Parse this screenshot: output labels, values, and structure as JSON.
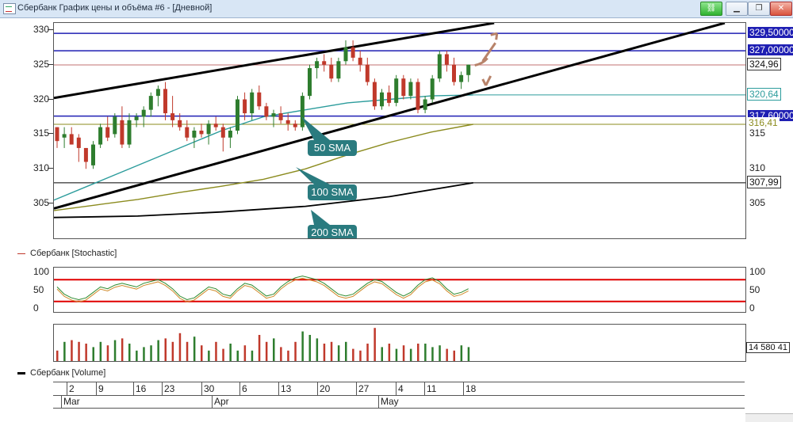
{
  "window": {
    "title": "Сбербанк График цены и объёма #6 - [Дневной]",
    "buttons": [
      "link",
      "minimize",
      "restore",
      "close"
    ]
  },
  "price_panel": {
    "y_ticks_left": [
      "330",
      "325",
      "320",
      "315",
      "310",
      "305"
    ],
    "y_ticks_right": [
      "315",
      "310",
      "305"
    ],
    "price_tags": [
      {
        "label": "329,50000",
        "style": "blue"
      },
      {
        "label": "327,00000",
        "style": "blue"
      },
      {
        "label": "324,96",
        "style": "plain"
      },
      {
        "label": "320,64",
        "style": "teal"
      },
      {
        "label": "317,60000",
        "style": "blue"
      },
      {
        "label": "316,41",
        "style": "olive"
      },
      {
        "label": "307,99",
        "style": "plain"
      }
    ],
    "callouts": [
      "50 SMA",
      "100 SMA",
      "200 SMA"
    ]
  },
  "stochastic_panel": {
    "legend": "Сбербанк [Stochastic]",
    "y_ticks": [
      "100",
      "50",
      "0"
    ]
  },
  "volume_panel": {
    "legend": "Сбербанк [Volume]",
    "last_volume": "14 580 41"
  },
  "x_axis": {
    "day_labels": [
      "2",
      "9",
      "16",
      "23",
      "30",
      "6",
      "13",
      "20",
      "27",
      "4",
      "11",
      "18"
    ],
    "month_labels": [
      "Mar",
      "Apr",
      "May"
    ]
  },
  "colors": {
    "up": "#2e7d2e",
    "down": "#c0392b",
    "sma50": "#2c9c9c",
    "sma100": "#8b8b1e",
    "sma200": "#000000",
    "level_blue": "#1f1fb3",
    "callout": "#2a7b7f",
    "arrow": "#b8836a",
    "stoch_band": "#e00000"
  },
  "chart_data": {
    "type": "candlestick",
    "price_range": [
      300,
      331
    ],
    "candles": [
      [
        316,
        316,
        313,
        314
      ],
      [
        314.5,
        316,
        313,
        315
      ],
      [
        315,
        316,
        313.5,
        313.5
      ],
      [
        314.5,
        315,
        311,
        313
      ],
      [
        313,
        313,
        310,
        311
      ],
      [
        310.5,
        314,
        310,
        313.5
      ],
      [
        313.5,
        316.5,
        313,
        316
      ],
      [
        316,
        317.5,
        314,
        314.5
      ],
      [
        315,
        318,
        314.5,
        317.5
      ],
      [
        317,
        319,
        313,
        313.5
      ],
      [
        313.5,
        318,
        313,
        317
      ],
      [
        317,
        318,
        316,
        317.5
      ],
      [
        317.5,
        319,
        316,
        318.5
      ],
      [
        318.5,
        321,
        317.5,
        320.5
      ],
      [
        320.5,
        322,
        319,
        321.5
      ],
      [
        321.5,
        322.5,
        317,
        318
      ],
      [
        318,
        320.5,
        316,
        317
      ],
      [
        317,
        318,
        315.5,
        316
      ],
      [
        316,
        317,
        314,
        314.5
      ],
      [
        314.5,
        316,
        313,
        315.5
      ],
      [
        315.5,
        316.5,
        314.5,
        315
      ],
      [
        315,
        317,
        313.5,
        316.5
      ],
      [
        316.5,
        317.5,
        315.5,
        316
      ],
      [
        316,
        316.5,
        312.5,
        314.5
      ],
      [
        314.5,
        316,
        313,
        315.5
      ],
      [
        315.5,
        320.5,
        315,
        320
      ],
      [
        320,
        321,
        317,
        318
      ],
      [
        318,
        321.5,
        317,
        321
      ],
      [
        321,
        322,
        318.5,
        319
      ],
      [
        319,
        319.5,
        317,
        317.5
      ],
      [
        317.5,
        318.5,
        316,
        318
      ],
      [
        318,
        319,
        316.5,
        317
      ],
      [
        317,
        318,
        315.5,
        316.5
      ],
      [
        316.5,
        317,
        315.5,
        316
      ],
      [
        316,
        321,
        315.5,
        320.5
      ],
      [
        320.5,
        325,
        320,
        324.5
      ],
      [
        324.5,
        326,
        323,
        325.5
      ],
      [
        325.5,
        326.5,
        324,
        325
      ],
      [
        325,
        326,
        322.5,
        323
      ],
      [
        323,
        326,
        322.5,
        325.5
      ],
      [
        325.5,
        328.5,
        325,
        327.5
      ],
      [
        327.5,
        328.5,
        325.5,
        326
      ],
      [
        326,
        327,
        324,
        325
      ],
      [
        325,
        326,
        322,
        322.5
      ],
      [
        322.5,
        323,
        318.5,
        319
      ],
      [
        319,
        321.5,
        318.5,
        321
      ],
      [
        321,
        322,
        319,
        319.5
      ],
      [
        319.5,
        323.5,
        319,
        323
      ],
      [
        323,
        323.5,
        320,
        320.5
      ],
      [
        320.5,
        323,
        320,
        322.5
      ],
      [
        322.5,
        323,
        318,
        318.5
      ],
      [
        318.5,
        320.5,
        318,
        320
      ],
      [
        320,
        323.5,
        319.5,
        323
      ],
      [
        323,
        327,
        322.5,
        326.5
      ],
      [
        326.5,
        327,
        324,
        325
      ],
      [
        325,
        326,
        322,
        322.5
      ],
      [
        322.5,
        324,
        321.5,
        323.5
      ],
      [
        323.5,
        325,
        322.5,
        325
      ]
    ],
    "series": [
      {
        "name": "50 SMA",
        "values": [
          [
            0,
            305.5
          ],
          [
            0.1,
            308.0
          ],
          [
            0.2,
            310.5
          ],
          [
            0.3,
            313.0
          ],
          [
            0.4,
            315.5
          ],
          [
            0.5,
            317.5
          ],
          [
            0.6,
            318.5
          ],
          [
            0.7,
            319.5
          ],
          [
            0.8,
            320.0
          ],
          [
            0.9,
            320.5
          ],
          [
            1,
            320.64
          ]
        ]
      },
      {
        "name": "100 SMA",
        "values": [
          [
            0,
            304.0
          ],
          [
            0.1,
            304.8
          ],
          [
            0.2,
            305.6
          ],
          [
            0.3,
            306.6
          ],
          [
            0.4,
            307.5
          ],
          [
            0.5,
            308.5
          ],
          [
            0.6,
            310.0
          ],
          [
            0.7,
            312.0
          ],
          [
            0.8,
            313.8
          ],
          [
            0.9,
            315.3
          ],
          [
            1,
            316.41
          ]
        ]
      },
      {
        "name": "200 SMA",
        "values": [
          [
            0,
            303.0
          ],
          [
            0.2,
            303.2
          ],
          [
            0.4,
            303.8
          ],
          [
            0.6,
            304.6
          ],
          [
            0.8,
            306.0
          ],
          [
            1,
            307.99
          ]
        ]
      }
    ],
    "horizontal_levels": [
      329.5,
      327.0,
      324.96,
      317.6,
      307.99
    ],
    "trendlines": [
      {
        "name": "upper channel",
        "from": [
          0,
          320.2
        ],
        "to": [
          1.05,
          331.0
        ]
      },
      {
        "name": "lower support",
        "from": [
          0,
          304.3
        ],
        "to": [
          1.6,
          331.0
        ]
      }
    ],
    "volume": [
      0.3,
      0.55,
      0.6,
      0.55,
      0.5,
      0.4,
      0.55,
      0.45,
      0.6,
      0.65,
      0.5,
      0.3,
      0.4,
      0.45,
      0.6,
      0.65,
      0.55,
      0.8,
      0.55,
      0.7,
      0.45,
      0.3,
      0.55,
      0.35,
      0.5,
      0.3,
      0.45,
      0.3,
      0.75,
      0.55,
      0.65,
      0.4,
      0.3,
      0.55,
      0.85,
      0.75,
      0.65,
      0.5,
      0.55,
      0.45,
      0.55,
      0.35,
      0.3,
      0.5,
      0.95,
      0.4,
      0.5,
      0.35,
      0.45,
      0.35,
      0.5,
      0.5,
      0.4,
      0.45,
      0.35,
      0.3,
      0.45,
      0.4
    ],
    "stochastic_k": [
      60,
      40,
      30,
      25,
      30,
      45,
      60,
      55,
      65,
      70,
      65,
      60,
      70,
      75,
      80,
      70,
      55,
      35,
      25,
      30,
      45,
      60,
      55,
      40,
      35,
      55,
      70,
      65,
      50,
      35,
      40,
      60,
      75,
      85,
      90,
      85,
      80,
      70,
      55,
      40,
      35,
      40,
      55,
      70,
      80,
      75,
      60,
      45,
      35,
      45,
      65,
      80,
      85,
      75,
      55,
      40,
      45,
      55
    ]
  }
}
